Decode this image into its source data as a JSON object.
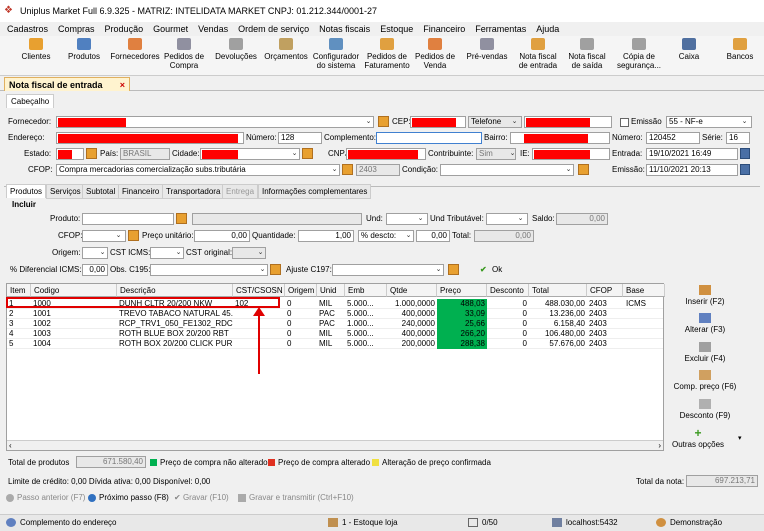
{
  "app": {
    "title": "Uniplus Market Full 6.9.325 - MATRIZ: INTELIDATA MARKET CNPJ: 01.212.344/0001-27"
  },
  "menu": [
    "Cadastros",
    "Compras",
    "Produção",
    "Gourmet",
    "Vendas",
    "Ordem de serviço",
    "Notas fiscais",
    "Estoque",
    "Financeiro",
    "Ferramentas",
    "Ajuda"
  ],
  "toolbar": [
    {
      "label": "Clientes",
      "icon": "users-icon"
    },
    {
      "label": "Produtos",
      "icon": "box-icon"
    },
    {
      "label": "Fornecedores",
      "icon": "truck-icon"
    },
    {
      "label": "Pedidos de\nCompra",
      "icon": "cart-icon"
    },
    {
      "label": "Devoluções",
      "icon": "return-icon"
    },
    {
      "label": "Orçamentos",
      "icon": "quote-icon"
    },
    {
      "label": "Configurador\ndo sistema",
      "icon": "config-icon"
    },
    {
      "label": "Pedidos de\nFaturamento",
      "icon": "billing-icon"
    },
    {
      "label": "Pedidos de\nVenda",
      "icon": "sale-icon"
    },
    {
      "label": "Pré-vendas",
      "icon": "presale-icon"
    },
    {
      "label": "Nota fiscal\nde entrada",
      "icon": "invoice-in-icon"
    },
    {
      "label": "Nota fiscal\nde saída",
      "icon": "invoice-out-icon"
    },
    {
      "label": "Cópia de\nsegurança...",
      "icon": "backup-icon"
    },
    {
      "label": "Caixa",
      "icon": "cash-icon"
    },
    {
      "label": "Bancos",
      "icon": "bank-icon"
    }
  ],
  "doc_tab": {
    "label": "Nota fiscal de entrada",
    "close": "×"
  },
  "header_tab": "Cabeçalho",
  "form": {
    "fornecedor_label": "Fornecedor:",
    "cep_label": "CEP:",
    "telefone_value": "Telefone",
    "emissao_check_label": "Emissão",
    "modelo_value": "55 - NF-e",
    "endereco_label": "Endereço:",
    "numero_label": "Número:",
    "numero_value": "128",
    "complemento_label": "Complemento:",
    "bairro_label": "Bairro:",
    "numero_nf_label": "Número:",
    "numero_nf_value": "120452",
    "serie_label": "Série:",
    "serie_value": "16",
    "estado_label": "Estado:",
    "pais_label": "País:",
    "pais_value": "BRASIL",
    "cidade_label": "Cidade:",
    "cnpj_label": "CNPJ",
    "contribuinte_label": "Contribuinte:",
    "contribuinte_value": "Sim",
    "ie_label": "IE:",
    "entrada_label": "Entrada:",
    "entrada_value": "19/10/2021 16:49",
    "cfop_label": "CFOP:",
    "cfop_value": "Compra mercadorias comercialização subs.tributária",
    "cfop_code": "2403",
    "condicao_label": "Condição:",
    "emissao_label": "Emissão:",
    "emissao_value": "11/10/2021 20:13"
  },
  "subtabs": [
    "Produtos",
    "Serviços",
    "Subtotal",
    "Financeiro",
    "Transportadora",
    "Entrega",
    "Informações complementares"
  ],
  "incluir": {
    "title": "Incluir",
    "produto_label": "Produto:",
    "und_label": "Und:",
    "und_trib_label": "Und Tributável:",
    "saldo_label": "Saldo:",
    "saldo_value": "0,00",
    "cfop_label": "CFOP:",
    "preco_unit_label": "Preço unitário:",
    "preco_unit_value": "0,00",
    "quantidade_label": "Quantidade:",
    "quantidade_value": "1,00",
    "pct_descto_value": "% descto:",
    "descto_value": "0,00",
    "total_label": "Total:",
    "total_value": "0,00",
    "origem_label": "Origem:",
    "cst_icms_label": "CST ICMS:",
    "cst_original_label": "CST original:",
    "dif_icms_label": "% Diferencial ICMS:",
    "dif_icms_value": "0,00",
    "obs_label": "Obs. C195:",
    "ajuste_label": "Ajuste C197:",
    "ok_label": "Ok"
  },
  "grid": {
    "headers": [
      "Item",
      "Codigo",
      "Descrição",
      "CST/CSOSN",
      "Origem",
      "Unid",
      "Emb",
      "Qtde",
      "Preço",
      "Desconto",
      "Total",
      "CFOP",
      "Base ICMS"
    ],
    "rows": [
      [
        "1",
        "1000",
        "DUNH CLTR 20/200 NKW",
        "102",
        "0",
        "MIL",
        "5.000...",
        "1.000,0000",
        "488,03",
        "0",
        "488.030,00",
        "2403"
      ],
      [
        "2",
        "1001",
        "TREVO TABACO NATURAL 45...",
        "",
        "0",
        "PAC",
        "5.000...",
        "400,0000",
        "33,09",
        "0",
        "13.236,00",
        "2403"
      ],
      [
        "3",
        "1002",
        "RCP_TRV1_050_FE1302_RDC",
        "",
        "0",
        "PAC",
        "1.000...",
        "240,0000",
        "25,66",
        "0",
        "6.158,40",
        "2403"
      ],
      [
        "4",
        "1003",
        "ROTH BLUE BOX 20/200 RBT",
        "",
        "0",
        "MIL",
        "5.000...",
        "400,0000",
        "266,20",
        "0",
        "106.480,00",
        "2403"
      ],
      [
        "5",
        "1004",
        "ROTH BOX 20/200 CLICK PUR...",
        "",
        "0",
        "MIL",
        "5.000...",
        "200,0000",
        "288,38",
        "0",
        "57.676,00",
        "2403"
      ]
    ]
  },
  "side_buttons": [
    {
      "label": "Inserir (F2)",
      "icon": "insert-icon"
    },
    {
      "label": "Alterar (F3)",
      "icon": "edit-icon"
    },
    {
      "label": "Excluir (F4)",
      "icon": "delete-icon"
    },
    {
      "label": "Comp. preço (F6)",
      "icon": "compare-price-icon"
    },
    {
      "label": "Desconto (F9)",
      "icon": "discount-icon"
    },
    {
      "label": "Outras opções",
      "icon": "plus-icon"
    }
  ],
  "totals": {
    "total_produtos_label": "Total de produtos",
    "total_produtos_value": "671.580,40",
    "legend1": "Preço de compra não alterado",
    "legend2": "Preço de compra alterado",
    "legend3": "Alteração de preço confirmada",
    "limite": "Limite de crédito: 0,00 Dívida ativa: 0,00 Disponível: 0,00",
    "total_nota_label": "Total da nota:",
    "total_nota_value": "697.213,71",
    "colors": {
      "green": "#00b050",
      "red": "#e03020",
      "yellow": "#f0e040"
    }
  },
  "footer_buttons": [
    "Passo anterior (F7)",
    "Próximo passo (F8)",
    "Gravar (F10)",
    "Gravar e transmitir (Ctrl+F10)"
  ],
  "status": {
    "hint": "Complemento do endereço",
    "estoque": "1 - Estoque loja",
    "counter": "0/50",
    "server": "localhost:5432",
    "user": "Demonstração"
  }
}
